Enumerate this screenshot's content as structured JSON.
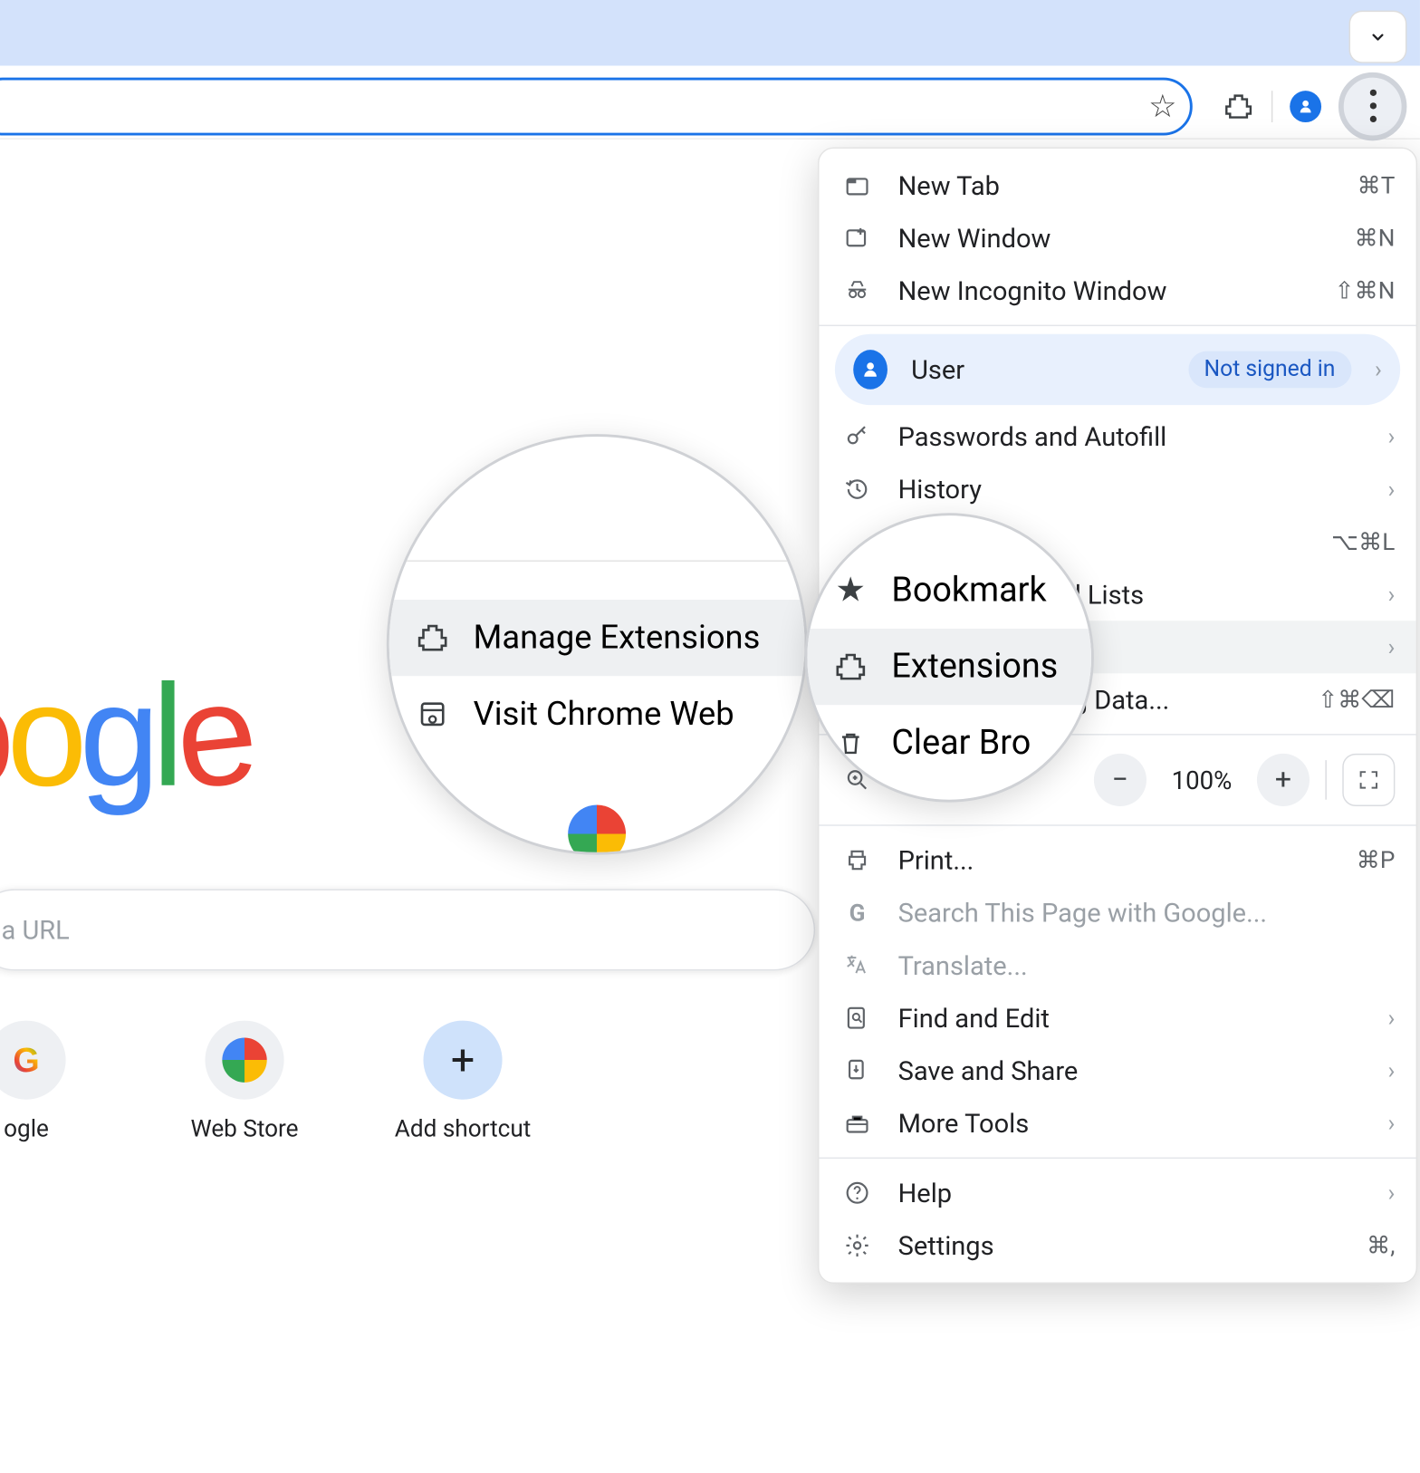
{
  "toolbar": {
    "star_title": "Bookmark this tab"
  },
  "page": {
    "logo_text": "oogle",
    "search_placeholder": "a URL",
    "shortcuts": [
      {
        "label": "ogle"
      },
      {
        "label": "Web Store"
      },
      {
        "label": "Add shortcut"
      }
    ]
  },
  "menu": {
    "new_tab": "New Tab",
    "new_tab_key": "⌘T",
    "new_window": "New Window",
    "new_window_key": "⌘N",
    "incognito": "New Incognito Window",
    "incognito_key": "⇧⌘N",
    "user": "User",
    "user_status": "Not signed in",
    "passwords": "Passwords and Autofill",
    "history": "History",
    "downloads_key": "⌥⌘L",
    "bookmarks": "Bookmarks and Lists",
    "extensions": "Extensions",
    "clear_data": "Delete Browsing Data...",
    "clear_data_key": "⇧⌘⌫",
    "zoom": "Zoom",
    "zoom_val": "100%",
    "print": "Print...",
    "print_key": "⌘P",
    "search_page": "Search This Page with Google...",
    "translate": "Translate...",
    "find_edit": "Find and Edit",
    "save_share": "Save and Share",
    "more_tools": "More Tools",
    "help": "Help",
    "settings": "Settings",
    "settings_key": "⌘,"
  },
  "mag1": {
    "item1": "Manage Extensions",
    "item2": "Visit Chrome Web"
  },
  "mag2": {
    "bookmark": "Bookmark",
    "extensions": "Extensions",
    "clear": "Clear Bro"
  }
}
